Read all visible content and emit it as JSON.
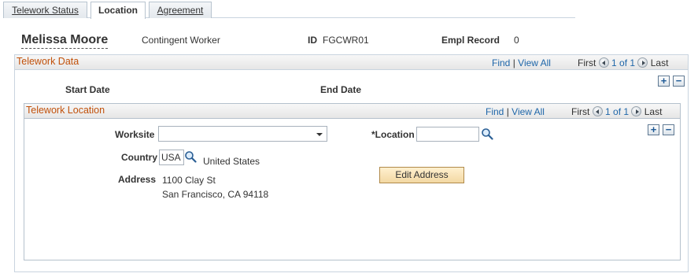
{
  "tabs": [
    {
      "label": "Telework Status",
      "active": false
    },
    {
      "label": "Location",
      "active": true
    },
    {
      "label": "Agreement",
      "active": false
    }
  ],
  "employee": {
    "name": "Melissa Moore",
    "type": "Contingent Worker",
    "id_label": "ID",
    "id_value": "FGCWR01",
    "empl_record_label": "Empl Record",
    "empl_record_value": "0"
  },
  "telework_data": {
    "title": "Telework Data",
    "find": "Find",
    "separator": "|",
    "view_all": "View All",
    "first": "First",
    "pager": "1 of 1",
    "last": "Last",
    "start_date_label": "Start Date",
    "end_date_label": "End Date",
    "add_symbol": "+",
    "remove_symbol": "−"
  },
  "telework_location": {
    "title": "Telework Location",
    "find": "Find",
    "separator": "|",
    "view_all": "View All",
    "first": "First",
    "pager": "1 of 1",
    "last": "Last",
    "add_symbol": "+",
    "remove_symbol": "−",
    "worksite_label": "Worksite",
    "worksite_value": "",
    "location_label": "*Location",
    "location_value": "",
    "country_label": "Country",
    "country_value": "USA",
    "country_description": "United States",
    "address_label": "Address",
    "address_line1": "1100 Clay St",
    "address_line2": "San Francisco, CA 94118",
    "edit_address_label": "Edit Address"
  },
  "colors": {
    "frame_title": "#c1510b",
    "link": "#1e66a9",
    "button_bg": "#f3d8a3"
  }
}
